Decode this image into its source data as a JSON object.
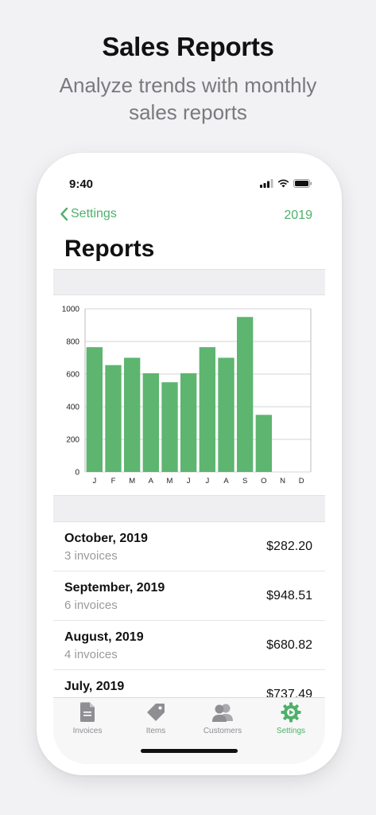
{
  "promo": {
    "headline": "Sales Reports",
    "subhead": "Analyze trends with monthly sales reports"
  },
  "status_bar": {
    "time": "9:40",
    "icons": [
      "cellular-signal-icon",
      "wifi-icon",
      "battery-icon"
    ]
  },
  "navbar": {
    "back_label": "Settings",
    "year": "2019",
    "title": "Reports"
  },
  "accent_color": "#4fb06a",
  "chart_data": {
    "type": "bar",
    "title": "",
    "xlabel": "",
    "ylabel": "",
    "categories": [
      "J",
      "F",
      "M",
      "A",
      "M",
      "J",
      "J",
      "A",
      "S",
      "O",
      "N",
      "D"
    ],
    "values": [
      765,
      655,
      700,
      605,
      550,
      605,
      765,
      700,
      950,
      350,
      null,
      null
    ],
    "ylim": [
      0,
      1000
    ],
    "yticks": [
      "0",
      "200",
      "400",
      "600",
      "800",
      "1000"
    ],
    "grid": true,
    "bar_color": "#5db570"
  },
  "reports": [
    {
      "month": "October, 2019",
      "invoices": "3 invoices",
      "amount": "$282.20"
    },
    {
      "month": "September, 2019",
      "invoices": "6 invoices",
      "amount": "$948.51"
    },
    {
      "month": "August, 2019",
      "invoices": "4 invoices",
      "amount": "$680.82"
    },
    {
      "month": "July, 2019",
      "invoices": "",
      "amount": "$737.49"
    }
  ],
  "tabbar": {
    "invoices": "Invoices",
    "items": "Items",
    "customers": "Customers",
    "settings": "Settings"
  }
}
